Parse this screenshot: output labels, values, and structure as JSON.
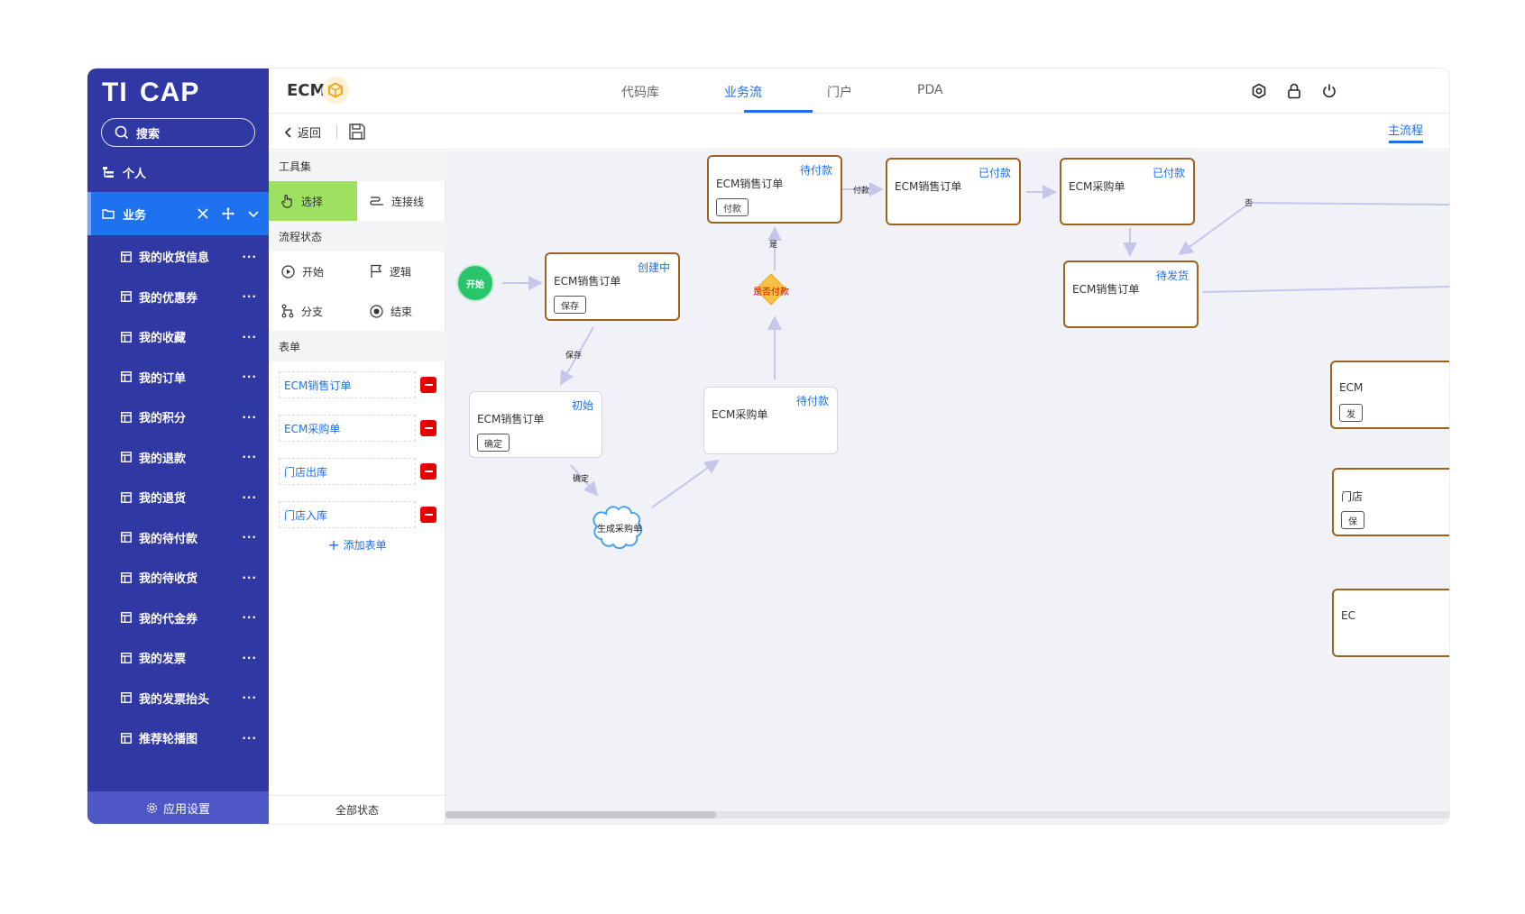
{
  "brand": {
    "left": "TI",
    "right": "CAP"
  },
  "sidebar": {
    "search_label": "搜索",
    "personal_label": "个人",
    "business_label": "业务",
    "items": [
      {
        "label": "我的收货信息"
      },
      {
        "label": "我的优惠券"
      },
      {
        "label": "我的收藏"
      },
      {
        "label": "我的订单"
      },
      {
        "label": "我的积分"
      },
      {
        "label": "我的退款"
      },
      {
        "label": "我的退货"
      },
      {
        "label": "我的待付款"
      },
      {
        "label": "我的待收货"
      },
      {
        "label": "我的代金券"
      },
      {
        "label": "我的发票"
      },
      {
        "label": "我的发票抬头"
      },
      {
        "label": "推荐轮播图"
      }
    ],
    "more": "···",
    "settings_label": "应用设置"
  },
  "header": {
    "app_name": "ECM",
    "tabs": [
      {
        "label": "代码库"
      },
      {
        "label": "业务流"
      },
      {
        "label": "门户"
      },
      {
        "label": "PDA"
      }
    ],
    "active_tab": "业务流",
    "icons": [
      "settings-hex-icon",
      "lock-icon",
      "power-icon"
    ]
  },
  "subbar": {
    "back_label": "返回",
    "main_flow_label": "主流程"
  },
  "toolpanel": {
    "toolset_title": "工具集",
    "select_label": "选择",
    "connect_label": "连接线",
    "status_title": "流程状态",
    "start_label": "开始",
    "logic_label": "逻辑",
    "branch_label": "分支",
    "end_label": "结束",
    "form_title": "表单",
    "forms": [
      {
        "label": "ECM销售订单"
      },
      {
        "label": "ECM采购单"
      },
      {
        "label": "门店出库"
      },
      {
        "label": "门店入库"
      }
    ],
    "add_form_label": "添加表单",
    "all_status_label": "全部状态"
  },
  "canvas": {
    "start": "开始",
    "nodes": [
      {
        "title": "ECM销售订单",
        "status": "创建中",
        "button": "保存"
      },
      {
        "title": "ECM销售订单",
        "status": "初始",
        "button": "确定"
      },
      {
        "title": "ECM采购单",
        "status": "待付款"
      },
      {
        "title": "ECM销售订单",
        "status": "待付款",
        "button": "付款"
      },
      {
        "title": "ECM销售订单",
        "status": "已付款"
      },
      {
        "title": "ECM采购单",
        "status": "已付款"
      },
      {
        "title": "ECM销售订单",
        "status": "待发货"
      },
      {
        "title": "ECM",
        "button": "发"
      },
      {
        "title": "门店",
        "button": "保"
      },
      {
        "title": "EC"
      }
    ],
    "decision": "是否付款",
    "cloud": "生成采购单",
    "edge_labels": {
      "save": "保存",
      "confirm": "确定",
      "yes": "是",
      "pay": "付款",
      "no": "否"
    }
  },
  "colors": {
    "sidebar": "#3038a4",
    "active_item": "#1f72ef",
    "accent": "#1f6fe8",
    "node_border": "#9a6420",
    "start": "#29c56b",
    "decision": "#f5c242",
    "select_tool": "#9ee05f",
    "delete": "#e80000"
  }
}
